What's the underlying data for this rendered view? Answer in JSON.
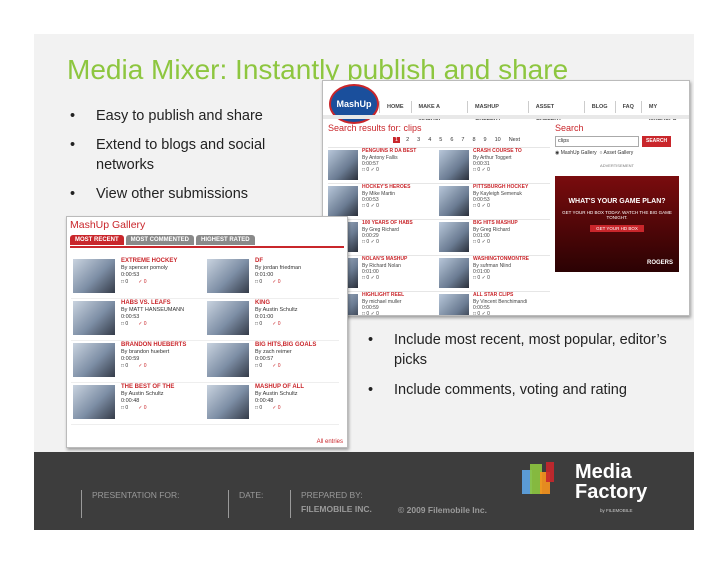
{
  "slide": {
    "title": "Media Mixer: Instantly publish and share",
    "bullets_left": [
      "Easy to publish and share",
      "Extend to blogs and social networks",
      "View other submissions"
    ],
    "bullets_right": [
      "Include most recent, most popular, editor’s picks",
      "Include comments, voting and rating"
    ],
    "bullet_glyph": "•"
  },
  "search_screenshot": {
    "logo": "MashUp",
    "nav": [
      "HOME",
      "MAKE A MASHUP",
      "MASHUP GALLERY",
      "ASSET GALLERY",
      "BLOG",
      "FAQ",
      "MY MASHUPS"
    ],
    "heading": "Search results for: clips",
    "pages": [
      "1",
      "2",
      "3",
      "4",
      "5",
      "6",
      "7",
      "8",
      "9",
      "10",
      "Next"
    ],
    "current_page": "1",
    "results": [
      {
        "title": "PENGUINS R DA BEST",
        "by": "By Antony Fallis",
        "time": "0:00:57",
        "comments": "0",
        "votes": "0"
      },
      {
        "title": "CRASH COURSE TO",
        "by": "By Arthur Toggert",
        "time": "0:00:31",
        "comments": "0",
        "votes": "0"
      },
      {
        "title": "HOCKEY'S HEROES",
        "by": "By Mike Martin",
        "time": "0:00:53",
        "comments": "0",
        "votes": "0"
      },
      {
        "title": "PITTSBURGH HOCKEY",
        "by": "By Kayleigh Semenuk",
        "time": "0:00:53",
        "comments": "0",
        "votes": "0"
      },
      {
        "title": "100 YEARS OF HABS",
        "by": "By Greg Richard",
        "time": "0:00:29",
        "comments": "0",
        "votes": "0"
      },
      {
        "title": "BIG HITS MASHUP",
        "by": "By Greg Richard",
        "time": "0:01:00",
        "comments": "0",
        "votes": "0"
      },
      {
        "title": "NOLAN'S MASHUP",
        "by": "By Richard Nolan",
        "time": "0:01:00",
        "comments": "0",
        "votes": "0"
      },
      {
        "title": "WASHINGTONMONTRE",
        "by": "By sufrman Nlind",
        "time": "0:01:00",
        "comments": "0",
        "votes": "0"
      },
      {
        "title": "HIGHLIGHT REEL",
        "by": "By michael muller",
        "time": "0:00:59",
        "comments": "0",
        "votes": "0"
      },
      {
        "title": "ALL STAR CLIPS",
        "by": "By Vincent Benchimandi",
        "time": "0:00:55",
        "comments": "0",
        "votes": "0"
      }
    ],
    "search": {
      "title": "Search",
      "value": "clips",
      "button": "SEARCH",
      "options": [
        "MashUp Gallery",
        "Asset Gallery"
      ]
    },
    "ad": {
      "label": "ADVERTISEMENT",
      "headline": "WHAT'S YOUR GAME PLAN?",
      "sub": "GET YOUR HD BOX TODAY. WATCH THE BIG GAME TONIGHT.",
      "cta": "GET YOUR HD BOX",
      "brand": "ROGERS"
    }
  },
  "gallery_screenshot": {
    "title": "MashUp Gallery",
    "tabs": [
      "MOST RECENT",
      "MOST COMMENTED",
      "HIGHEST RATED"
    ],
    "items": [
      {
        "title": "EXTREME HOCKEY",
        "by": "By spencer pomoly",
        "time": "0:00:53",
        "comments": "0",
        "votes": "0"
      },
      {
        "title": "DF",
        "by": "By jordan friedman",
        "time": "0:01:00",
        "comments": "0",
        "votes": "0"
      },
      {
        "title": "HABS VS. LEAFS",
        "by": "By MATT HANSEUMANN",
        "time": "0:00:53",
        "comments": "0",
        "votes": "0"
      },
      {
        "title": "KING",
        "by": "By Austin Schultz",
        "time": "0:01:00",
        "comments": "0",
        "votes": "0"
      },
      {
        "title": "BRANDON HUEBERTS",
        "by": "By brandon huebert",
        "time": "0:00:59",
        "comments": "0",
        "votes": "0"
      },
      {
        "title": "BIG HITS,BIG GOALS",
        "by": "By zach reimer",
        "time": "0:00:57",
        "comments": "0",
        "votes": "0"
      },
      {
        "title": "THE BEST OF THE",
        "by": "By Austin Schultz",
        "time": "0:00:48",
        "comments": "0",
        "votes": "0"
      },
      {
        "title": "MASHUP OF ALL",
        "by": "By Austin Schultz",
        "time": "0:00:48",
        "comments": "0",
        "votes": "0"
      }
    ],
    "all_entries": "All entries"
  },
  "footer": {
    "presentation_for": "PRESENTATION FOR:",
    "date": "DATE:",
    "prepared_by": "PREPARED BY:",
    "prepared_by_value": "FILEMOBILE INC.",
    "copyright": "© 2009 Filemobile Inc.",
    "logo_line1": "Media",
    "logo_line2": "Factory",
    "logo_by": "by FILEMOBILE"
  },
  "colors": {
    "accent_green": "#8dc63f",
    "brand_red": "#c9262b",
    "footer_bg": "#3d3d3d"
  }
}
